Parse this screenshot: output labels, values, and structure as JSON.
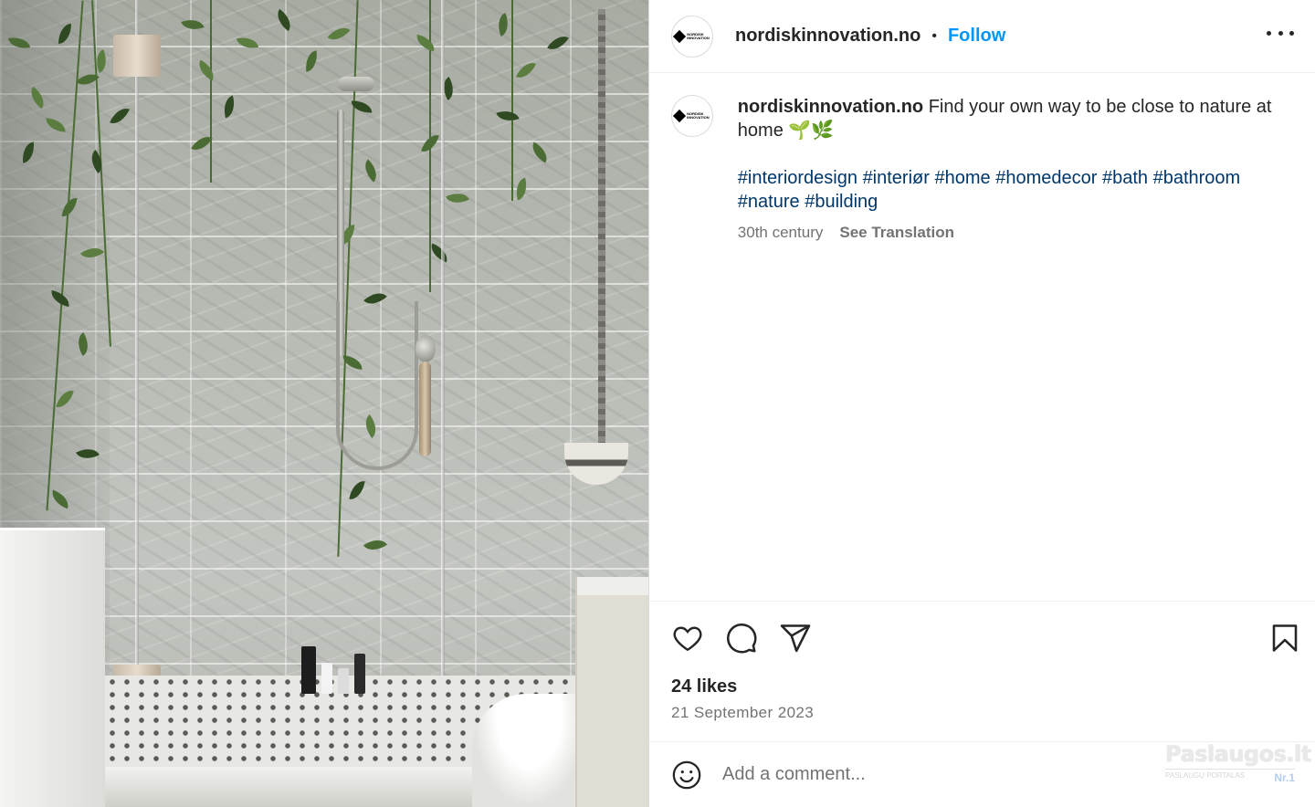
{
  "post": {
    "image_alt": "Marble-tiled walk-in shower with trailing pothos plants and a hanging planter",
    "account": {
      "username": "nordiskinnovation.no",
      "avatar_label_line1": "NORDISK",
      "avatar_label_line2": "INNOVATION"
    },
    "header": {
      "separator": "•",
      "follow_label": "Follow",
      "more_icon": "more-horizontal-icon"
    },
    "caption": {
      "username": "nordiskinnovation.no",
      "text": "Find your own way to be close to nature at home 🌱🌿",
      "hashtags": [
        "#interiordesign",
        "#interiør",
        "#home",
        "#homedecor",
        "#bath",
        "#bathroom",
        "#nature",
        "#building"
      ],
      "timestamp": "30th century",
      "see_translation": "See Translation"
    },
    "actions": {
      "like_icon": "heart-icon",
      "comment_icon": "comment-icon",
      "share_icon": "send-icon",
      "save_icon": "bookmark-icon"
    },
    "likes": "24 likes",
    "date": "21 September 2023",
    "comment": {
      "emoji_icon": "smiley-icon",
      "placeholder": "Add a comment..."
    }
  },
  "watermark": {
    "title": "Paslaugos.lt",
    "subtitle": "PASLAUGŲ PORTALAS",
    "badge": "Nr.1"
  },
  "colors": {
    "link_blue": "#0095f6",
    "hashtag_blue": "#00376b",
    "secondary_text": "#737373",
    "primary_text": "#262626",
    "divider": "#efefef"
  }
}
